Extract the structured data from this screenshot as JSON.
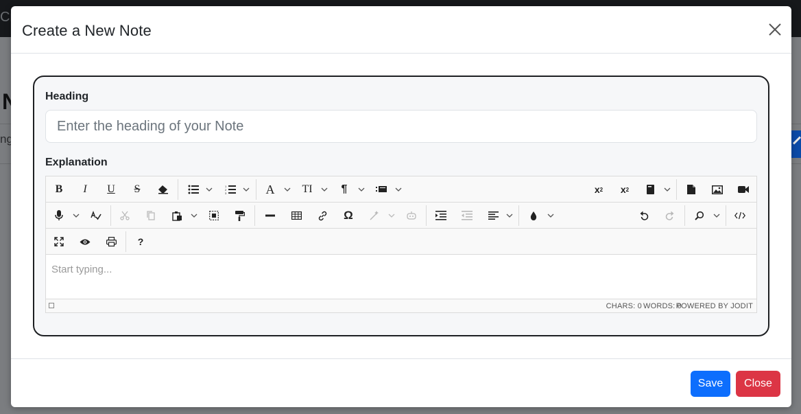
{
  "background": {
    "topbar_text": "Cr",
    "page_heading": "N",
    "tab_text": "ng"
  },
  "modal": {
    "title": "Create a New Note",
    "close_icon": "close-icon",
    "form": {
      "heading_label": "Heading",
      "heading_placeholder": "Enter the heading of your Note",
      "heading_value": "",
      "explanation_label": "Explanation"
    },
    "editor": {
      "placeholder": "Start typing...",
      "toolbar_icons": {
        "row1": [
          "bold-icon",
          "italic-icon",
          "underline-icon",
          "strikethrough-icon",
          "eraser-icon",
          "unordered-list-icon",
          "ordered-list-icon",
          "font-icon",
          "font-size-icon",
          "paragraph-icon",
          "classes-icon",
          "superscript-icon",
          "subscript-icon",
          "file-icon",
          "file-upload-icon",
          "image-icon",
          "video-icon"
        ],
        "row2": [
          "speech-recognize-icon",
          "spellcheck-icon",
          "cut-icon",
          "copy-icon",
          "paste-icon",
          "select-all-icon",
          "copy-format-icon",
          "horizontal-rule-icon",
          "table-icon",
          "link-icon",
          "symbols-icon",
          "ai-commands-icon",
          "ai-assistant-icon",
          "indent-icon",
          "outdent-icon",
          "align-icon",
          "brush-icon",
          "undo-icon",
          "redo-icon",
          "find-icon",
          "source-icon"
        ],
        "row3": [
          "fullsize-icon",
          "preview-icon",
          "print-icon",
          "about-icon"
        ]
      },
      "about_label": "?",
      "status": {
        "chars": "CHARS: 0",
        "words": "WORDS: 0",
        "powered": "POWERED BY JODIT"
      }
    },
    "footer": {
      "save_label": "Save",
      "close_label": "Close"
    }
  },
  "colors": {
    "primary": "#0d6efd",
    "danger": "#dc3545",
    "card_bg": "#f6f7f9"
  }
}
